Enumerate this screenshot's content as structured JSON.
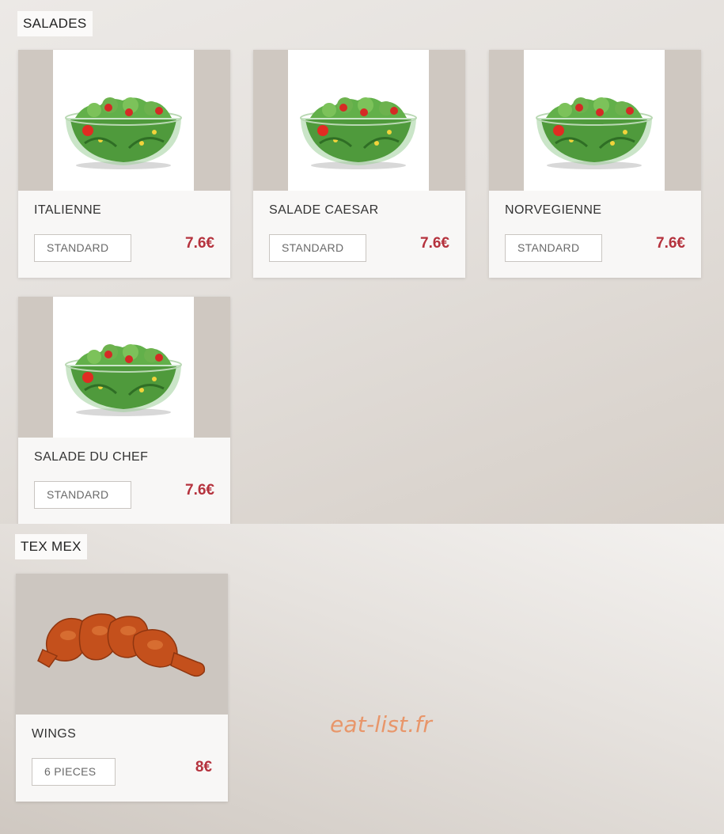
{
  "sections": [
    {
      "title": "SALADES",
      "items": [
        {
          "name": "ITALIENNE",
          "variant": "STANDARD",
          "price": "7.6€",
          "image": "salad-bowl-image"
        },
        {
          "name": "SALADE CAESAR",
          "variant": "STANDARD",
          "price": "7.6€",
          "image": "salad-bowl-image"
        },
        {
          "name": "NORVEGIENNE",
          "variant": "STANDARD",
          "price": "7.6€",
          "image": "salad-bowl-image"
        },
        {
          "name": "SALADE DU CHEF",
          "variant": "STANDARD",
          "price": "7.6€",
          "image": "salad-bowl-image"
        }
      ]
    },
    {
      "title": "TEX MEX",
      "items": [
        {
          "name": "WINGS",
          "variant": "6 PIECES",
          "price": "8€",
          "image": "chicken-wings-image"
        }
      ]
    }
  ],
  "watermark": "eat-list.fr",
  "colors": {
    "price": "#b5323d",
    "watermark": "#e8966a",
    "card_body": "#f8f7f6"
  }
}
